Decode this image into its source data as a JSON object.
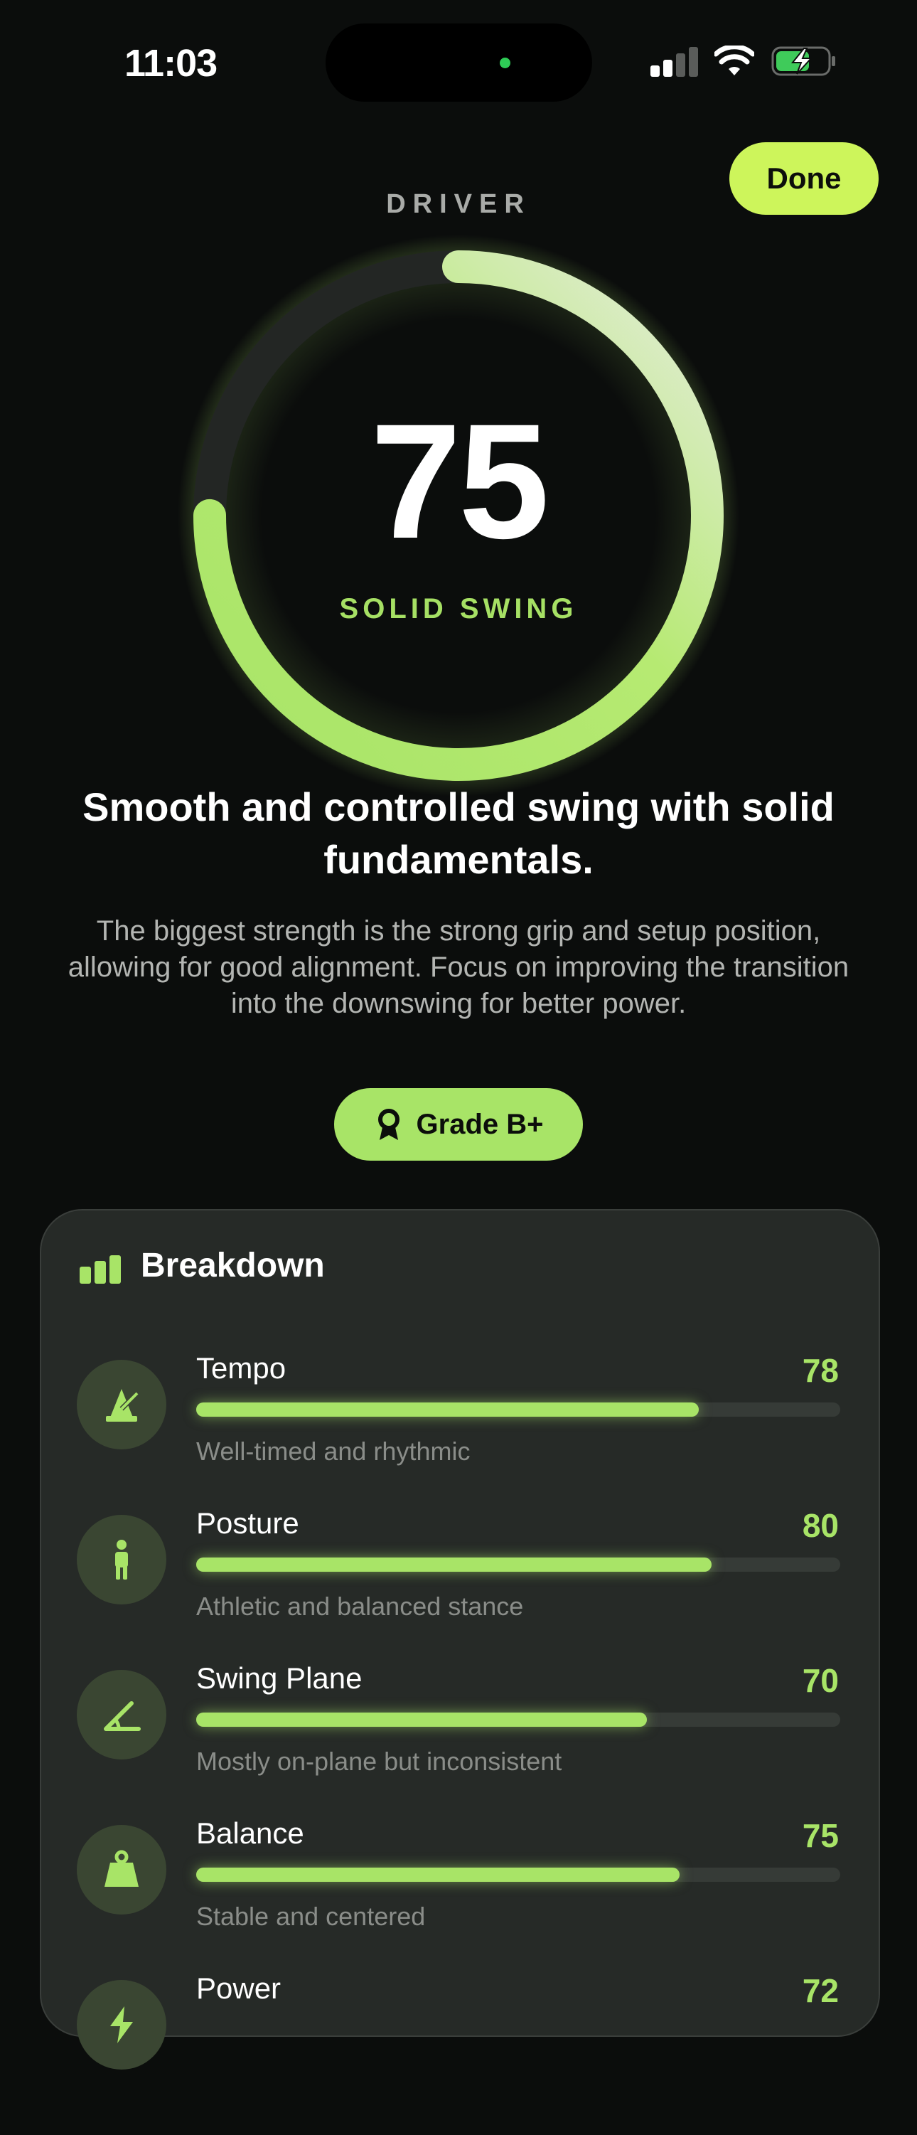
{
  "status_bar": {
    "time": "11:03"
  },
  "header": {
    "done_label": "Done",
    "club": "DRIVER"
  },
  "score": {
    "value": 75,
    "display": "75",
    "label": "SOLID SWING",
    "max": 100
  },
  "headline": "Smooth and controlled swing with solid fundamentals.",
  "summary": "The biggest strength is the strong grip and setup position, allowing for good alignment. Focus on improving the transition into the downswing for better power.",
  "grade": {
    "label": "Grade B+",
    "icon": "award-ribbon-icon"
  },
  "breakdown": {
    "title": "Breakdown",
    "icon": "bar-chart-icon",
    "items": [
      {
        "name": "Tempo",
        "value": "78",
        "score": 78,
        "description": "Well-timed and rhythmic",
        "icon": "metronome-icon"
      },
      {
        "name": "Posture",
        "value": "80",
        "score": 80,
        "description": "Athletic and balanced stance",
        "icon": "person-standing-icon"
      },
      {
        "name": "Swing Plane",
        "value": "70",
        "score": 70,
        "description": "Mostly on-plane but inconsistent",
        "icon": "angle-icon"
      },
      {
        "name": "Balance",
        "value": "75",
        "score": 75,
        "description": "Stable and centered",
        "icon": "weight-icon"
      },
      {
        "name": "Power",
        "value": "72",
        "score": 72,
        "description": "",
        "icon": "bolt-icon"
      }
    ]
  },
  "colors": {
    "accent": "#a8e467",
    "done_button": "#cdf55b",
    "background": "#0b0d0c",
    "card": "#262a27"
  }
}
